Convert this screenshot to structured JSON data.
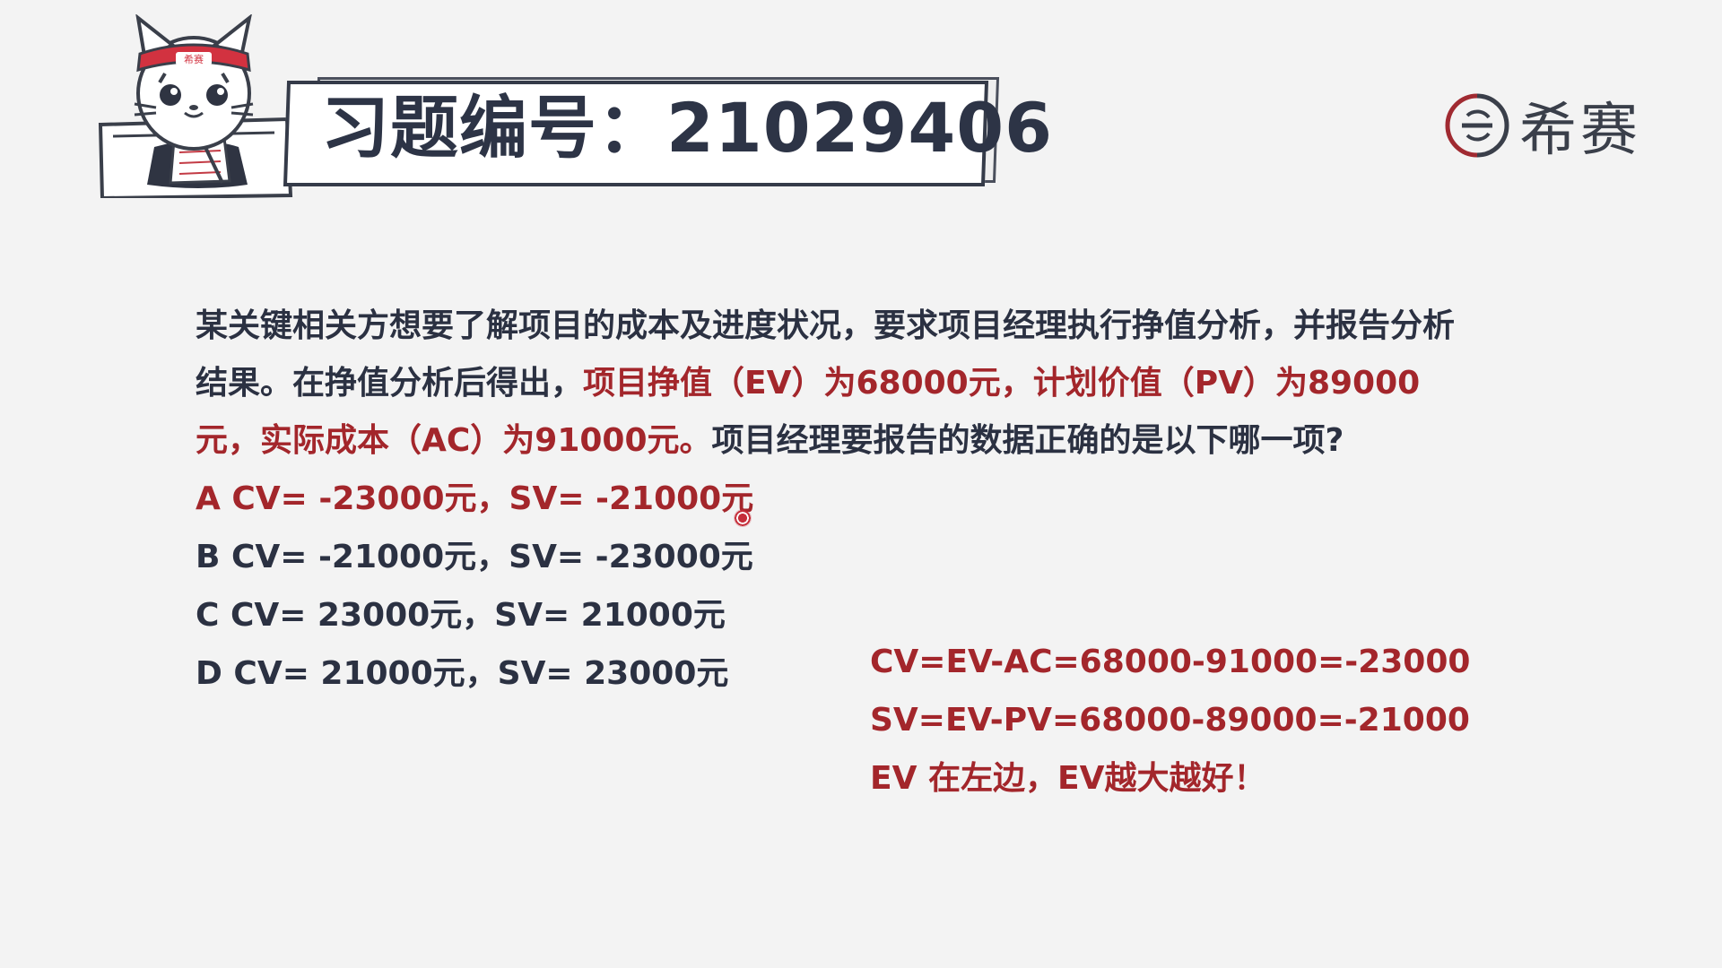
{
  "header": {
    "title": "习题编号：21029406",
    "mascot_headband": "希赛",
    "logo_text": "希赛"
  },
  "question": {
    "intro": "某关键相关方想要了解项目的成本及进度状况，要求项目经理执行挣值分析，并报告分析结果。在挣值分析后得出，",
    "highlight": "项目挣值（EV）为68000元，计划价值（PV）为89000元，实际成本（AC）为91000元。",
    "ending": "项目经理要报告的数据正确的是以下哪一项?"
  },
  "options": [
    {
      "text": "A CV= -23000元，SV= -21000元",
      "highlight": true
    },
    {
      "text": "B CV= -21000元，SV= -23000元",
      "highlight": false
    },
    {
      "text": "C CV= 23000元，SV= 21000元",
      "highlight": false
    },
    {
      "text": "D CV= 21000元，SV= 23000元",
      "highlight": false
    }
  ],
  "solution": {
    "line1": "CV=EV-AC=68000-91000=-23000",
    "line2": "SV=EV-PV=68000-89000=-21000",
    "line3": "EV 在左边，EV越大越好！"
  },
  "colors": {
    "text": "#2b3142",
    "highlight": "#a3262b",
    "background": "#f3f3f3",
    "title": "#2d3446"
  },
  "icons": {
    "mascot": "cat-mascot-icon",
    "logo": "xisai-logo-icon",
    "cursor": "cursor-dot-icon"
  }
}
